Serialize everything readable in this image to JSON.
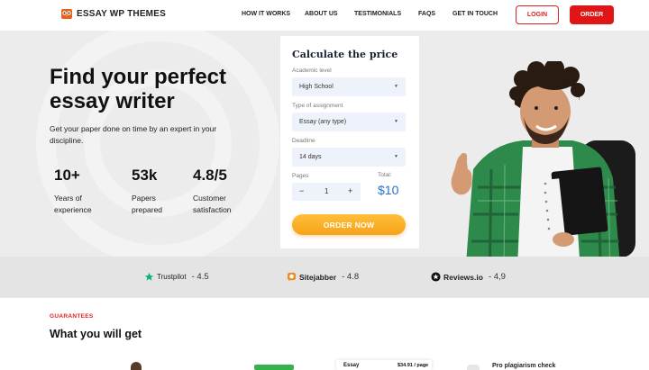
{
  "brand": {
    "name": "ESSAY WP THEMES"
  },
  "nav": {
    "items": [
      "HOW IT WORKS",
      "ABOUT US",
      "TESTIMONIALS",
      "FAQS",
      "GET IN TOUCH"
    ],
    "login_label": "LOGIN",
    "order_label": "ORDER"
  },
  "hero": {
    "title": "Find your perfect essay writer",
    "subtitle": "Get your paper done on time by an expert in your discipline.",
    "stats": [
      {
        "value": "10+",
        "label": "Years of experience"
      },
      {
        "value": "53k",
        "label": "Papers prepared"
      },
      {
        "value": "4.8/5",
        "label": "Customer satisfaction"
      }
    ]
  },
  "calculator": {
    "title": "Calculate the price",
    "academic_level_label": "Academic level",
    "academic_level_value": "High School",
    "assignment_label": "Type of assignment",
    "assignment_value": "Essay (any type)",
    "deadline_label": "Deadline",
    "deadline_value": "14 days",
    "pages_label": "Pages",
    "pages_value": "1",
    "minus": "−",
    "plus": "+",
    "total_label": "Total:",
    "total_value": "$10",
    "order_button": "ORDER NOW"
  },
  "ratings": [
    {
      "name": "Trustpilot",
      "score": "- 4.5",
      "icon": "trustpilot-star-icon",
      "color": "#00b67a"
    },
    {
      "name": "Sitejabber",
      "score": "- 4.8",
      "icon": "sitejabber-icon",
      "color": "#f08a24"
    },
    {
      "name": "Reviews.io",
      "score": "- 4,9",
      "icon": "reviews-io-star-icon",
      "color": "#111111"
    }
  ],
  "guarantees": {
    "tag": "GUARANTEES",
    "title": "What you will get",
    "peek": {
      "card_label": "Essay",
      "card_price": "$34.91 / page",
      "feature_label": "Pro plagiarism check"
    }
  },
  "colors": {
    "accent_red": "#e01515",
    "accent_orange": "#f6a219",
    "total_blue": "#2a6fd6",
    "hero_bg": "#ececec"
  }
}
